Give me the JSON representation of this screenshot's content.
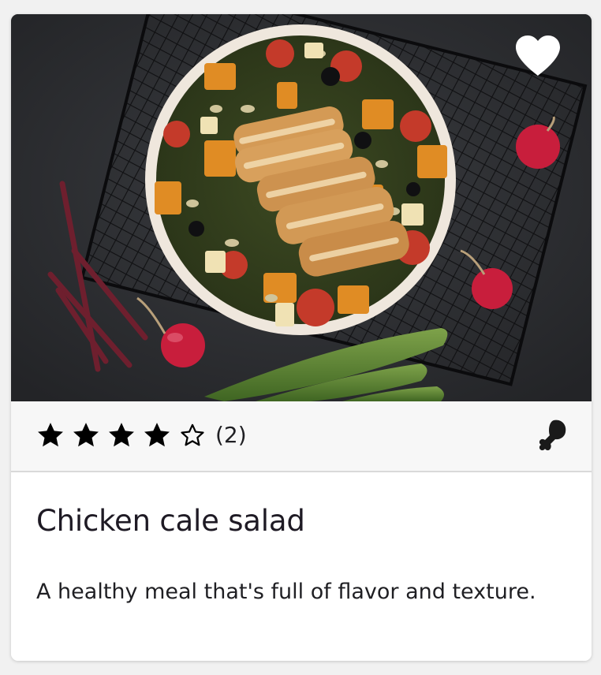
{
  "card": {
    "title": "Chicken cale salad",
    "description": "A healthy meal that's full of flavor and texture.",
    "image_alt": "Chicken kale salad bowl with roasted squash, tomatoes, olives and seeds",
    "favorite": {
      "icon": "heart-icon",
      "active": true
    },
    "rating": {
      "value": 4,
      "max": 5,
      "count_label": "(2)",
      "filled_icon": "star-filled-icon",
      "empty_icon": "star-outline-icon"
    },
    "diet_icon": "drumstick-icon"
  },
  "colors": {
    "text": "#1e1a24",
    "rating_bar_bg": "#f7f7f7",
    "photo_bg": "#2e3033"
  }
}
